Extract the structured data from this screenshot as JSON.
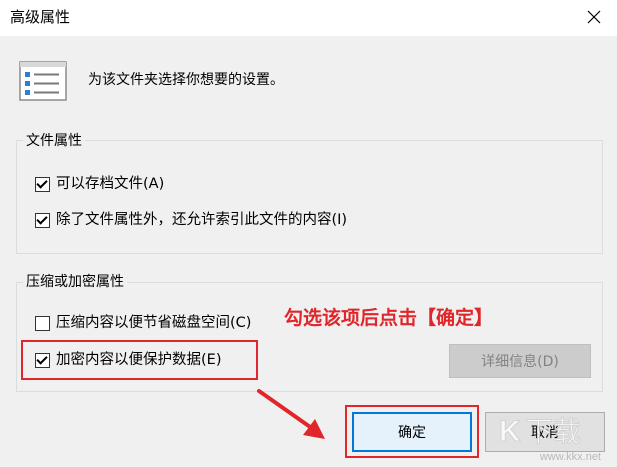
{
  "window": {
    "title": "高级属性",
    "close_icon": "close-icon"
  },
  "header": {
    "description": "为该文件夹选择你想要的设置。",
    "icon": "list-settings-icon"
  },
  "file_attributes": {
    "title": "文件属性",
    "options": [
      {
        "label": "可以存档文件(A)",
        "checked": true
      },
      {
        "label": "除了文件属性外，还允许索引此文件的内容(I)",
        "checked": true
      }
    ]
  },
  "compress_encrypt": {
    "title": "压缩或加密属性",
    "options": [
      {
        "label": "压缩内容以便节省磁盘空间(C)",
        "checked": false
      },
      {
        "label": "加密内容以便保护数据(E)",
        "checked": true
      }
    ],
    "details_button": "详细信息(D)"
  },
  "buttons": {
    "ok": "确定",
    "cancel": "取消"
  },
  "annotation": {
    "text": "勾选该项后点击【确定】",
    "color": "#e0262a"
  },
  "watermark": {
    "text": "www.kkx.net"
  }
}
